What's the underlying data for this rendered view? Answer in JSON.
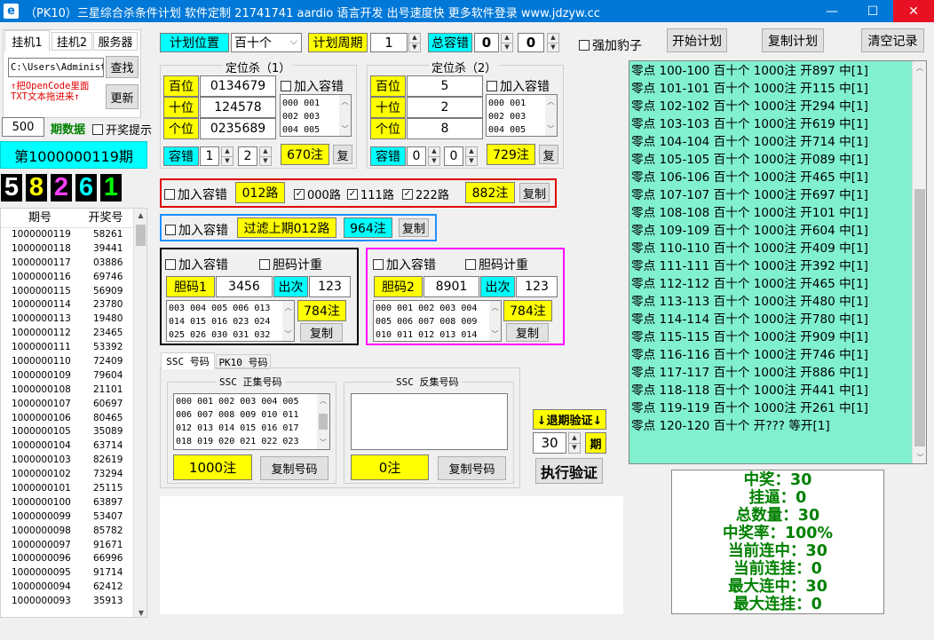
{
  "window": {
    "title": "（PK10）三星综合杀条件计划 软件定制 21741741 aardio 语言开发 出号速度快 更多软件登录 www.jdzyw.cc",
    "minimize": "—",
    "maximize": "☐",
    "close": "✕"
  },
  "left": {
    "tabs": [
      "挂机1",
      "挂机2",
      "服务器"
    ],
    "path_value": "C:\\Users\\Administ",
    "find_label": "查找",
    "refresh_label": "更新",
    "hint_line1": "↑把OpenCode里面",
    "hint_line2": "TXT文本拖进来↑",
    "count_value": "500",
    "period_data_label": "期数据",
    "open_hint_label": "开奖提示",
    "current_period": "第1000000119期",
    "digits": [
      "5",
      "8",
      "2",
      "6",
      "1"
    ],
    "digit_colors": [
      "#ffffff",
      "#ffff00",
      "#ff40ff",
      "#00ffff",
      "#00ff00"
    ],
    "col_period": "期号",
    "col_number": "开奖号",
    "rows": [
      [
        "1000000119",
        "58261"
      ],
      [
        "1000000118",
        "39441"
      ],
      [
        "1000000117",
        "03886"
      ],
      [
        "1000000116",
        "69746"
      ],
      [
        "1000000115",
        "56909"
      ],
      [
        "1000000114",
        "23780"
      ],
      [
        "1000000113",
        "19480"
      ],
      [
        "1000000112",
        "23465"
      ],
      [
        "1000000111",
        "53392"
      ],
      [
        "1000000110",
        "72409"
      ],
      [
        "1000000109",
        "79604"
      ],
      [
        "1000000108",
        "21101"
      ],
      [
        "1000000107",
        "60697"
      ],
      [
        "1000000106",
        "80465"
      ],
      [
        "1000000105",
        "35089"
      ],
      [
        "1000000104",
        "63714"
      ],
      [
        "1000000103",
        "82619"
      ],
      [
        "1000000102",
        "73294"
      ],
      [
        "1000000101",
        "25115"
      ],
      [
        "1000000100",
        "63897"
      ],
      [
        "1000000099",
        "53407"
      ],
      [
        "1000000098",
        "85782"
      ],
      [
        "1000000097",
        "91671"
      ],
      [
        "1000000096",
        "66996"
      ],
      [
        "1000000095",
        "91714"
      ],
      [
        "1000000094",
        "62412"
      ],
      [
        "1000000093",
        "35913"
      ]
    ]
  },
  "top": {
    "plan_pos_label": "计划位置",
    "plan_pos_value": "百十个",
    "plan_cycle_label": "计划周期",
    "plan_cycle_value": "1",
    "total_tol_label": "总容错",
    "total_tol_value1": "0",
    "total_tol_value2": "0",
    "leopard_label": "强加豹子",
    "start_plan": "开始计划",
    "copy_plan": "复制计划",
    "clear_record": "清空记录"
  },
  "kill1": {
    "title": "定位杀（1）",
    "bai_label": "百位",
    "bai_value": "0134679",
    "shi_label": "十位",
    "shi_value": "124578",
    "ge_label": "个位",
    "ge_value": "0235689",
    "add_tol": "加入容错",
    "nums": [
      "000  001",
      "002  003",
      "004  005"
    ],
    "tol_label": "容错",
    "tol_value1": "1",
    "tol_value2": "2",
    "count": "670注",
    "copy": "复"
  },
  "kill2": {
    "title": "定位杀（2）",
    "bai_label": "百位",
    "bai_value": "5",
    "shi_label": "十位",
    "shi_value": "2",
    "ge_label": "个位",
    "ge_value": "8",
    "add_tol": "加入容错",
    "nums": [
      "000  001",
      "002  003",
      "004  005"
    ],
    "tol_label": "容错",
    "tol_value1": "0",
    "tol_value2": "0",
    "count": "729注",
    "copy": "复"
  },
  "road": {
    "add_tol": "加入容错",
    "road_label": "012路",
    "r000": "000路",
    "r111": "111路",
    "r222": "222路",
    "count": "882注",
    "copy": "复制"
  },
  "filter": {
    "add_tol": "加入容错",
    "label": "过滤上期012路",
    "count": "964注",
    "copy": "复制"
  },
  "dan1": {
    "add_tol": "加入容错",
    "count_check": "胆码计重",
    "dan_label": "胆码1",
    "dan_value": "3456",
    "times_label": "出次",
    "times_value": "123",
    "nums": [
      "003  004  005  006  013",
      "014  015  016  023  024",
      "025  026  030  031  032"
    ],
    "count": "784注",
    "copy": "复制"
  },
  "dan2": {
    "add_tol": "加入容错",
    "count_check": "胆码计重",
    "dan_label": "胆码2",
    "dan_value": "8901",
    "times_label": "出次",
    "times_value": "123",
    "nums": [
      "000  001  002  003  004",
      "005  006  007  008  009",
      "010  011  012  013  014"
    ],
    "count": "784注",
    "copy": "复制"
  },
  "ssc": {
    "tabs": [
      "SSC 号码",
      "PK10 号码"
    ],
    "pos_title": "SSC 正集号码",
    "neg_title": "SSC 反集号码",
    "pos_nums": [
      "000  001  002  003  004  005",
      "006  007  008  009  010  011",
      "012  013  014  015  016  017",
      "018  019  020  021  022  023"
    ],
    "pos_count": "1000注",
    "neg_count": "0注",
    "copy_label": "复制号码"
  },
  "verify": {
    "back_label": "↓退期验证↓",
    "periods_value": "30",
    "period_unit": "期",
    "run_label": "执行验证"
  },
  "results": [
    "零点 100-100 百十个 1000注 开897 中[1]",
    "零点 101-101 百十个 1000注 开115 中[1]",
    "零点 102-102 百十个 1000注 开294 中[1]",
    "零点 103-103 百十个 1000注 开619 中[1]",
    "零点 104-104 百十个 1000注 开714 中[1]",
    "零点 105-105 百十个 1000注 开089 中[1]",
    "零点 106-106 百十个 1000注 开465 中[1]",
    "零点 107-107 百十个 1000注 开697 中[1]",
    "零点 108-108 百十个 1000注 开101 中[1]",
    "零点 109-109 百十个 1000注 开604 中[1]",
    "零点 110-110 百十个 1000注 开409 中[1]",
    "零点 111-111 百十个 1000注 开392 中[1]",
    "零点 112-112 百十个 1000注 开465 中[1]",
    "零点 113-113 百十个 1000注 开480 中[1]",
    "零点 114-114 百十个 1000注 开780 中[1]",
    "零点 115-115 百十个 1000注 开909 中[1]",
    "零点 116-116 百十个 1000注 开746 中[1]",
    "零点 117-117 百十个 1000注 开886 中[1]",
    "零点 118-118 百十个 1000注 开441 中[1]",
    "零点 119-119 百十个 1000注 开261 中[1]",
    "零点 120-120 百十个 开???  等开[1]"
  ],
  "stats": [
    "中奖：30",
    "挂逼：0",
    "总数量：30",
    "中奖率：100%",
    "当前连中：30",
    "当前连挂：0",
    "最大连中：30",
    "最大连挂：0"
  ]
}
